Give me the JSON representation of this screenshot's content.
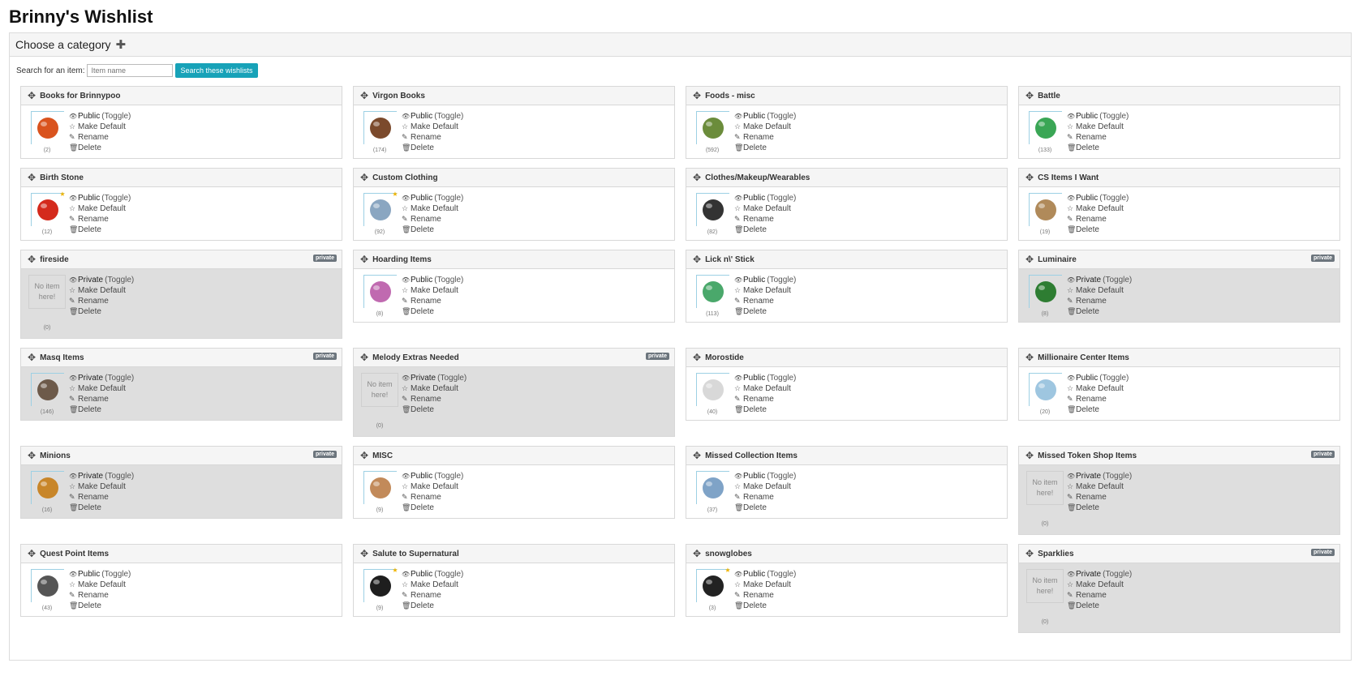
{
  "page_title": "Brinny's Wishlist",
  "category_header": "Choose a category",
  "search": {
    "label": "Search for an item:",
    "placeholder": "Item name",
    "button_label": "Search these wishlists"
  },
  "actions": {
    "toggle": "(Toggle)",
    "make_default": "Make Default",
    "rename": "Rename",
    "delete": "Delete",
    "public": "Public",
    "private": "Private",
    "private_badge": "private",
    "no_item": "No item here!"
  },
  "colors": {
    "accent": "#17a2b8",
    "private_bg": "#dedede",
    "badge": "#6c757d"
  },
  "wishlists": [
    {
      "name": "Books for Brinnypoo",
      "count": "(2)",
      "visibility": "public",
      "icon": "red-book-icon",
      "color": "#d9531e",
      "star": false
    },
    {
      "name": "Virgon Books",
      "count": "(174)",
      "visibility": "public",
      "icon": "brown-book-icon",
      "color": "#7b4a2c",
      "star": false
    },
    {
      "name": "Foods - misc",
      "count": "(592)",
      "visibility": "public",
      "icon": "food-icon",
      "color": "#6b8c3b",
      "star": false
    },
    {
      "name": "Battle",
      "count": "(133)",
      "visibility": "public",
      "icon": "green-gem-icon",
      "color": "#3aa655",
      "star": false
    },
    {
      "name": "Birth Stone",
      "count": "(12)",
      "visibility": "public",
      "icon": "red-stone-necklace-icon",
      "color": "#d42a1c",
      "star": true
    },
    {
      "name": "Custom Clothing",
      "count": "(92)",
      "visibility": "public",
      "icon": "clothing-icon",
      "color": "#8aa6c1",
      "star": true
    },
    {
      "name": "Clothes/Makeup/Wearables",
      "count": "(82)",
      "visibility": "public",
      "icon": "paw-pendant-icon",
      "color": "#333333",
      "star": false
    },
    {
      "name": "CS Items I Want",
      "count": "(19)",
      "visibility": "public",
      "icon": "bundle-icon",
      "color": "#b08a5a",
      "star": false
    },
    {
      "name": "fireside",
      "count": "(0)",
      "visibility": "private",
      "icon": "",
      "color": "",
      "star": false
    },
    {
      "name": "Hoarding Items",
      "count": "(8)",
      "visibility": "public",
      "icon": "pink-fruit-icon",
      "color": "#c06ab0",
      "star": false
    },
    {
      "name": "Lick n\\' Stick",
      "count": "(113)",
      "visibility": "public",
      "icon": "sticker-plate-icon",
      "color": "#4aa86b",
      "star": false
    },
    {
      "name": "Luminaire",
      "count": "(8)",
      "visibility": "private",
      "icon": "green-box-icon",
      "color": "#2e7d32",
      "star": false
    },
    {
      "name": "Masq Items",
      "count": "(146)",
      "visibility": "private",
      "icon": "masq-figure-icon",
      "color": "#6d5a4a",
      "star": false
    },
    {
      "name": "Melody Extras Needed",
      "count": "(0)",
      "visibility": "private",
      "icon": "",
      "color": "",
      "star": false
    },
    {
      "name": "Morostide",
      "count": "(40)",
      "visibility": "public",
      "icon": "skull-icon",
      "color": "#d8d8d8",
      "star": false
    },
    {
      "name": "Millionaire Center Items",
      "count": "(20)",
      "visibility": "public",
      "icon": "ghost-icon",
      "color": "#9ec6e0",
      "star": false
    },
    {
      "name": "Minions",
      "count": "(16)",
      "visibility": "private",
      "icon": "lion-icon",
      "color": "#c8862a",
      "star": false
    },
    {
      "name": "MISC",
      "count": "(9)",
      "visibility": "public",
      "icon": "puppy-icon",
      "color": "#c28a5a",
      "star": false
    },
    {
      "name": "Missed Collection Items",
      "count": "(37)",
      "visibility": "public",
      "icon": "blue-creature-icon",
      "color": "#7fa3c7",
      "star": false
    },
    {
      "name": "Missed Token Shop Items",
      "count": "(0)",
      "visibility": "private",
      "icon": "",
      "color": "",
      "star": false
    },
    {
      "name": "Quest Point Items",
      "count": "(43)",
      "visibility": "public",
      "icon": "dark-orb-icon",
      "color": "#555555",
      "star": false
    },
    {
      "name": "Salute to Supernatural",
      "count": "(9)",
      "visibility": "public",
      "icon": "black-dress-icon",
      "color": "#1e1e1e",
      "star": true
    },
    {
      "name": "snowglobes",
      "count": "(3)",
      "visibility": "public",
      "icon": "snowglobe-icon",
      "color": "#222222",
      "star": true
    },
    {
      "name": "Sparklies",
      "count": "(0)",
      "visibility": "private",
      "icon": "",
      "color": "",
      "star": false
    }
  ]
}
